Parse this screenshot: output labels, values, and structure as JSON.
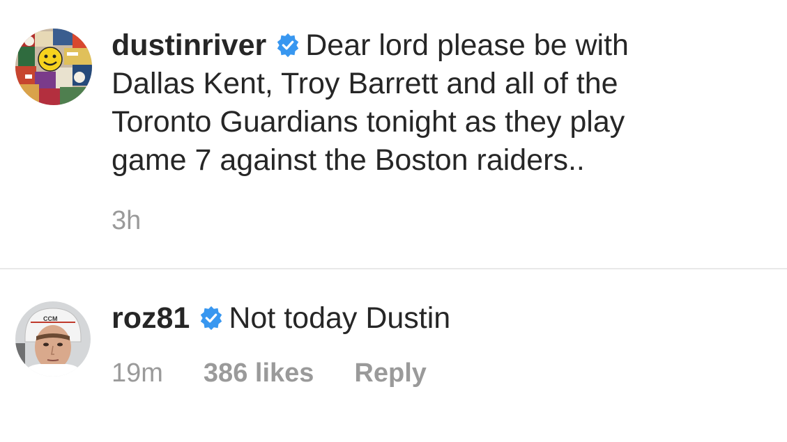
{
  "comments": [
    {
      "username": "dustinriver",
      "verified": true,
      "text": "Dear lord please be with Dallas Kent, Troy Barrett  and all of the Toronto Guardians tonight as they play game 7 against the Boston raiders..",
      "time": "3h",
      "avatar_icon": "sticker-collage-avatar"
    },
    {
      "username": "roz81",
      "verified": true,
      "text": "Not today Dustin",
      "time": "19m",
      "likes": "386 likes",
      "reply_label": "Reply",
      "avatar_icon": "hockey-player-avatar",
      "helmet_logo": "CCM"
    }
  ],
  "colors": {
    "text": "#262626",
    "meta": "#9a9a9a",
    "verified_badge": "#3897f0",
    "divider": "#e8e8e8"
  }
}
